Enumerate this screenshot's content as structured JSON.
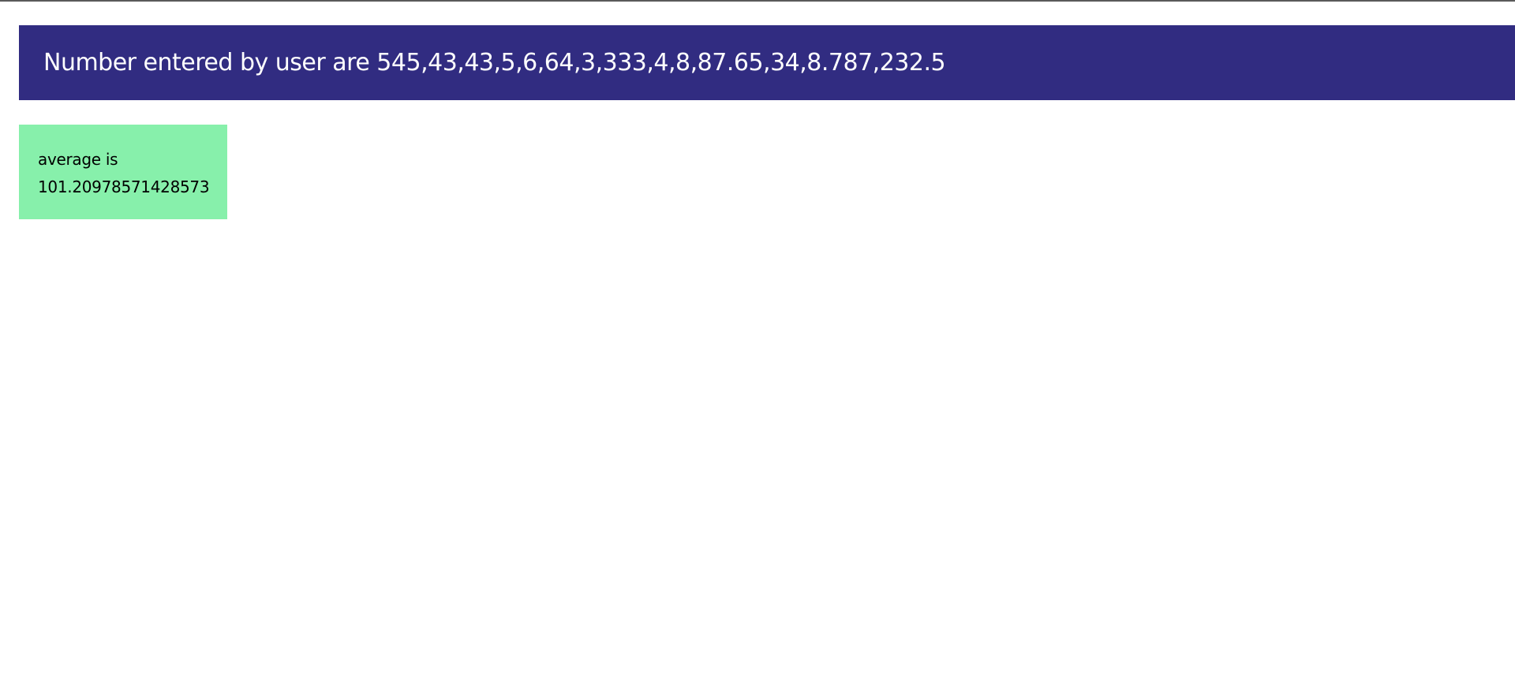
{
  "header": {
    "text": "Number entered by user are 545,43,43,5,6,64,3,333,4,8,87.65,34,8.787,232.5"
  },
  "result": {
    "label": "average is",
    "value": "101.20978571428573"
  },
  "colors": {
    "header_bg": "#312c81",
    "result_bg": "#87f0ab"
  }
}
